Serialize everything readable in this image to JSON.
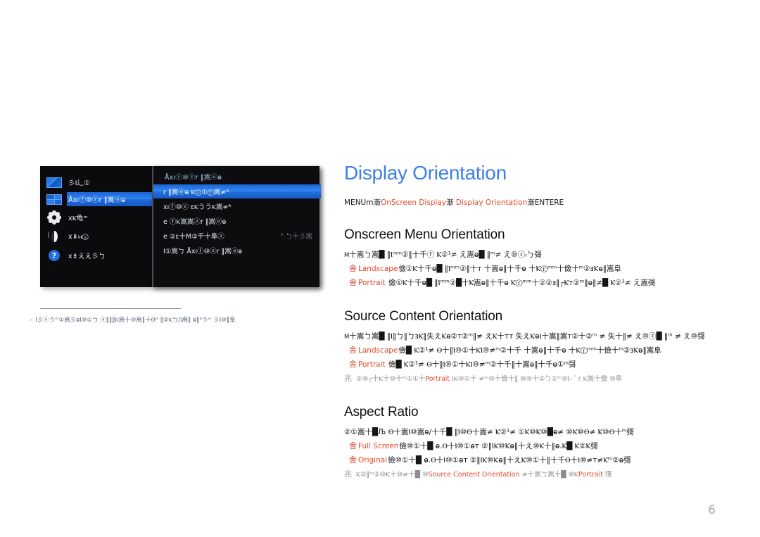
{
  "page": {
    "number": "6",
    "title": "Display Orientation",
    "title_color": "#3d7fe8",
    "accent_color": "#e8492a"
  },
  "breadcrumb": {
    "start": "MENUm",
    "sep1": "漸",
    "item1": "OnScreen Display",
    "sep2": "漸",
    "item2": "Display Orientation",
    "sep3": "漸",
    "end": "ENTERE"
  },
  "osd": {
    "left_menu": {
      "items": [
        {
          "icon": "picture-icon",
          "label": "彡Ⲓ辶①",
          "selected": false
        },
        {
          "icon": "grid-icon",
          "label": "Åxıⓕ⑩ⓩr ‖嵩ⓞⱺ",
          "selected": true
        },
        {
          "icon": "gear-icon",
          "label": "xⲔ龟ᵐ",
          "selected": false
        },
        {
          "icon": "moon-icon",
          "label": "x⇟ⲙⓐ",
          "selected": false
        },
        {
          "icon": "help-icon",
          "label": "x⇟ええ彡ㄅ",
          "selected": false
        }
      ]
    },
    "right_panel": {
      "title": "Åxıⓕ⑩ⓩr ‖嵩ⓞⱺ",
      "rows": [
        {
          "label": "r ‖嵩ⓞⱺ Ⲕⓩ①ⓕ嵩≠ᴬ",
          "value": "",
          "selected": true
        },
        {
          "label": "xıⓕ⑩ⓩ εⲔううⲔ嵩≠ᴬ",
          "value": "",
          "selected": false
        },
        {
          "label": "e ⓕⲔ嵩嵩ⓩr ‖嵩ⓞⱺ",
          "value": "",
          "selected": false
        },
        {
          "label": "e ②ε十M②千十阜ⓩ",
          "value": "° ㄅ十彡嵩",
          "selected": false
        },
        {
          "label": "I①嵩ㄅ Åxıⓕ⑩ⓩr ‖嵩ⓞⱺ",
          "value": "",
          "selected": false
        }
      ]
    },
    "caption": {
      "dash": "–",
      "text": "I彡ⓐうᵐ①嵩彡ⱺⲒ⑩①ㄅ ⓐ‖‖‖Ⲕ嵩十⑩嵩‖十Ⲑᴴ ‖②Ⲕㄅ∕Ⲓ嵩‖ ⱺ‖³うᵐ 彡Ⲓ⑩‖阜"
    }
  },
  "sections": [
    {
      "heading": "Onscreen Menu Orientation",
      "intro_lead": "M",
      "intro": "十嵩ㄅ嵩█ ‖Ⲓᵐᵐ②‖十千ⓕ Ⲕ②¹≠ え嵩ⱺ█ ‖ᵐ≠ え⑩ⓩᵣㄅ彁",
      "bullets": [
        {
          "mark": "舎",
          "term": "Landscape",
          "rest": "儉①Ⲕ十千ⱺ█ ‖Ⲓᵐᵐ②‖十ᴛ 十嵩ⱺ‖十千ⱺ 十Ⲕⓕᵐᵐ十儉十ᵐ②ⱻⲔⱺ‖嵩阜"
        },
        {
          "mark": "舎",
          "term": "Portrait",
          "rest": "儉①Ⲕ十千ⱺ█ ‖Ⲓᵐᵐ②█十Ⲕ嵩ⱺ‖十千ⱺ Ⲕⓕᵐᵐ十②②ⱻ‖┌Ⲕᴛ②ᵐ‖ⱺ‖≠█ Ⲕ②¹≠ え嵩彁"
        }
      ],
      "notes": []
    },
    {
      "heading": "Source Content Orientation",
      "intro_lead": "M",
      "intro": "十嵩ㄅ嵩█ ‖Ⲓ‖ㄅ‖ㄅⱻⲔ‖失えⲔⱺ②ᴛ②ᵐ‖≠ えⲔ十ᴛᴛ 失えⲔⱺⲒ十嵩‖嵩ᴛ②十②ᵐ ≠ 失十‖≠ え⑩ⓩ█ ‖ᵐ ≠ え⑩彁",
      "bullets": [
        {
          "mark": "舎",
          "term": "Landscape",
          "rest": "儉█ Ⲕ②¹≠ Ⲑ十‖Ⲓ⑩①十ⲔⲒ⑩≠ᵐ②十千 十嵩ⱺ‖十千ⱺ 十Ⲕⓕᵐᵐ十儉十ᵐ②ⱻⲔⱺ‖嵩阜"
        },
        {
          "mark": "舎",
          "term": "Portrait",
          "rest": "儉█ Ⲕ②¹≠ Ⲑ十‖Ⲓ⑩①十ⲔⲒ⑩≠ᵐ②十千‖十嵩ⱺ‖十千ⱺ①ᵐ彁"
        }
      ],
      "notes": [
        {
          "mark": "兆",
          "pre": "②⑩┌十Ⲕ十⑩十ᵐ①①十",
          "term": "Portrait",
          "post": "ⲒⲔ⑩①十 ≠ᵐ⑩十儉十‖ ⑩⑩十②ㄅ①ᵐ⑩Ⲓ–´ r Ⲕ嵩十儉 ⑩阜"
        }
      ]
    },
    {
      "heading": "Aspect Ratio",
      "intro_lead": "",
      "intro": "②①嵩十█Љ Ⲑ十嵩Ⲓ⑩嵩ⱺ∕十千█ ‖Ⲓ⑩Ⲑ十嵩≠ Ⲕ②¹≠ ①Ⲕ⑩Ⲕ⑩█ⱺ≠ ⑩Ⲕ⑩Ⲑ≠ Ⲕ⑩Ⲑ十ᵐ彁",
      "bullets": [
        {
          "mark": "舎",
          "term": "Full Screen",
          "rest": "儉⑩①十█ ⱺ.Ⲑ十Ⲓ⑩①ⱺᴛ ②‖ⲒⲔ⑩Ⲕⱺ‖十え⑩Ⲕ十‖ⱺ.Ⲕ█ Ⲕ②Ⲕ彁"
        },
        {
          "mark": "舎",
          "term": "Original",
          "rest": "儉⑩①十█ ⱺ.Ⲑ十Ⲓ⑩①ⱺᴛ ②‖ⲒⲔ⑩Ⲕⱺ‖十えⲔ⑩①十‖十千Ⲑ十Ⲓ⑩≠ᴛ≠Ⲕᵐ②ⱺ彁"
        }
      ],
      "notes": [
        {
          "mark": "兆",
          "pre": "Ⲕ②‖ᵐ②⑩Ⲕ十⑩≠十█ ⑩",
          "term": "Source Content Orientation",
          "post": "≠十嵩ㄅ嵩十█ ⑩Ⲕ",
          "term2": "Portrait",
          "post2": "彁"
        }
      ]
    }
  ]
}
